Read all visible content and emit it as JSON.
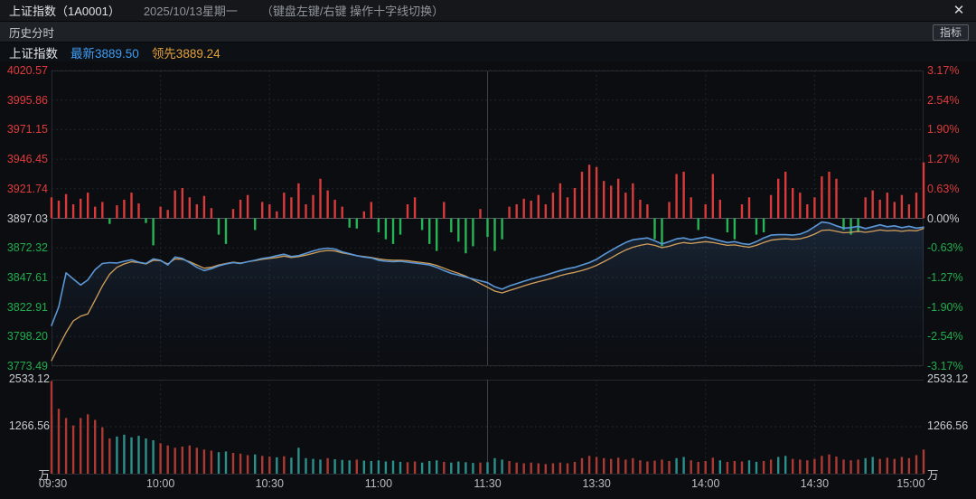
{
  "header": {
    "title": "上证指数（1A0001）",
    "date": "2025/10/13星期一",
    "hint": "（键盘左键/右键 操作十字线切换）",
    "close_icon": "✕",
    "subtitle": "历史分时",
    "indicator_button": "指标"
  },
  "legend": {
    "name": "上证指数",
    "latest": "最新3889.50",
    "lead": "领先3889.24"
  },
  "colors": {
    "up_red": "#e03b3b",
    "down_green": "#21ad4e",
    "neutral": "#c9ced3",
    "price_line": "#5b97d6",
    "avg_line": "#d3a05b",
    "hist_red": "#d93a3a",
    "hist_green": "#26b456",
    "vol_red": "#ad3a32",
    "vol_teal": "#2d8f8a",
    "vol_cyan": "#2fc6c0",
    "latest_blue": "#3f9df5",
    "lead_orange": "#e5a23c",
    "grid": "#21252c",
    "zero_line": "#565b61",
    "lunch_line": "#3d4147",
    "border": "#262a30"
  },
  "chart_data": {
    "type": "line",
    "title": "上证指数 历史分时 2025/10/13",
    "baseline_value": 3897.03,
    "latest_value": 3889.5,
    "lead_value": 3889.24,
    "pct_range": [
      -3.17,
      3.17
    ],
    "left_axis": [
      "4020.57",
      "3995.86",
      "3971.15",
      "3946.45",
      "3921.74",
      "3897.03",
      "3872.32",
      "3847.61",
      "3822.91",
      "3798.20",
      "3773.49"
    ],
    "right_axis": [
      "3.17%",
      "2.54%",
      "1.90%",
      "1.27%",
      "0.63%",
      "0.00%",
      "-0.63%",
      "-1.27%",
      "-1.90%",
      "-2.54%",
      "-3.17%"
    ],
    "axis_colors": [
      "r",
      "r",
      "r",
      "r",
      "r",
      "w",
      "g",
      "g",
      "g",
      "g",
      "g"
    ],
    "x_ticks": [
      "09:30",
      "10:00",
      "10:30",
      "11:00",
      "11:30",
      "13:30",
      "14:00",
      "14:30",
      "15:00"
    ],
    "x_tick_minutes": [
      0,
      30,
      60,
      90,
      120,
      150,
      180,
      210,
      240
    ],
    "sample_step_minutes": 2,
    "volume_axis": [
      "2533.12",
      "1266.56"
    ],
    "volume_unit": "万",
    "volume_max": 2533.12,
    "series": [
      {
        "name": "price_pct",
        "values": [
          -2.3,
          -1.9,
          -1.17,
          -1.3,
          -1.43,
          -1.32,
          -1.1,
          -0.97,
          -0.95,
          -0.96,
          -0.92,
          -0.89,
          -0.94,
          -0.97,
          -0.87,
          -0.9,
          -1.0,
          -0.83,
          -0.86,
          -0.95,
          -1.05,
          -1.12,
          -1.08,
          -1.02,
          -0.98,
          -0.95,
          -0.97,
          -0.93,
          -0.9,
          -0.86,
          -0.84,
          -0.8,
          -0.77,
          -0.82,
          -0.8,
          -0.75,
          -0.7,
          -0.66,
          -0.64,
          -0.66,
          -0.72,
          -0.76,
          -0.8,
          -0.83,
          -0.85,
          -0.9,
          -0.92,
          -0.93,
          -0.92,
          -0.94,
          -0.96,
          -0.98,
          -1.0,
          -1.05,
          -1.12,
          -1.18,
          -1.22,
          -1.26,
          -1.3,
          -1.34,
          -1.38,
          -1.47,
          -1.52,
          -1.45,
          -1.4,
          -1.35,
          -1.3,
          -1.26,
          -1.22,
          -1.17,
          -1.12,
          -1.08,
          -1.05,
          -1.0,
          -0.95,
          -0.88,
          -0.78,
          -0.69,
          -0.6,
          -0.52,
          -0.46,
          -0.44,
          -0.42,
          -0.48,
          -0.55,
          -0.5,
          -0.44,
          -0.42,
          -0.46,
          -0.43,
          -0.4,
          -0.44,
          -0.48,
          -0.52,
          -0.5,
          -0.54,
          -0.56,
          -0.5,
          -0.42,
          -0.36,
          -0.35,
          -0.35,
          -0.36,
          -0.34,
          -0.28,
          -0.18,
          -0.08,
          -0.1,
          -0.16,
          -0.21,
          -0.2,
          -0.17,
          -0.22,
          -0.18,
          -0.14,
          -0.18,
          -0.16,
          -0.2,
          -0.17,
          -0.21,
          -0.19
        ]
      },
      {
        "name": "avg_pct",
        "values": [
          -3.05,
          -2.75,
          -2.45,
          -2.2,
          -2.1,
          -2.05,
          -1.75,
          -1.45,
          -1.2,
          -1.05,
          -0.98,
          -0.93,
          -0.95,
          -0.98,
          -0.9,
          -0.91,
          -0.98,
          -0.87,
          -0.88,
          -0.93,
          -1.0,
          -1.07,
          -1.05,
          -1.0,
          -0.97,
          -0.94,
          -0.96,
          -0.93,
          -0.91,
          -0.88,
          -0.86,
          -0.84,
          -0.81,
          -0.84,
          -0.82,
          -0.79,
          -0.75,
          -0.71,
          -0.69,
          -0.7,
          -0.74,
          -0.77,
          -0.8,
          -0.82,
          -0.84,
          -0.87,
          -0.89,
          -0.9,
          -0.9,
          -0.91,
          -0.93,
          -0.95,
          -0.97,
          -1.01,
          -1.07,
          -1.13,
          -1.18,
          -1.24,
          -1.32,
          -1.4,
          -1.48,
          -1.56,
          -1.6,
          -1.55,
          -1.5,
          -1.45,
          -1.4,
          -1.36,
          -1.32,
          -1.28,
          -1.23,
          -1.19,
          -1.16,
          -1.12,
          -1.07,
          -1.01,
          -0.93,
          -0.85,
          -0.76,
          -0.68,
          -0.62,
          -0.58,
          -0.55,
          -0.58,
          -0.63,
          -0.6,
          -0.55,
          -0.52,
          -0.54,
          -0.52,
          -0.5,
          -0.52,
          -0.55,
          -0.58,
          -0.57,
          -0.6,
          -0.62,
          -0.58,
          -0.52,
          -0.47,
          -0.45,
          -0.44,
          -0.45,
          -0.44,
          -0.4,
          -0.34,
          -0.26,
          -0.25,
          -0.28,
          -0.31,
          -0.3,
          -0.28,
          -0.3,
          -0.28,
          -0.25,
          -0.27,
          -0.26,
          -0.28,
          -0.26,
          -0.27,
          -0.22
        ]
      },
      {
        "name": "minute_change_pct",
        "values": [
          0.45,
          0.38,
          0.52,
          0.3,
          0.42,
          0.55,
          0.25,
          0.35,
          -0.12,
          0.28,
          0.4,
          0.55,
          0.32,
          -0.1,
          -0.58,
          0.25,
          0.18,
          0.6,
          0.65,
          0.45,
          0.3,
          0.48,
          0.22,
          -0.35,
          -0.55,
          0.2,
          0.4,
          0.5,
          -0.25,
          0.35,
          0.3,
          0.15,
          0.55,
          0.45,
          0.75,
          0.3,
          0.5,
          0.85,
          0.6,
          0.4,
          0.25,
          -0.2,
          -0.22,
          0.15,
          0.35,
          -0.3,
          -0.45,
          -0.55,
          -0.35,
          0.3,
          0.45,
          -0.25,
          -0.55,
          -0.7,
          0.35,
          -0.3,
          -0.5,
          -0.75,
          -0.6,
          0.2,
          -0.4,
          -0.7,
          -0.45,
          0.25,
          0.3,
          0.42,
          0.38,
          0.5,
          0.3,
          0.55,
          0.75,
          0.45,
          0.65,
          1.0,
          1.15,
          1.1,
          0.8,
          0.7,
          0.85,
          0.55,
          0.75,
          0.4,
          0.3,
          -0.45,
          -0.6,
          0.35,
          0.95,
          1.0,
          0.45,
          -0.25,
          0.3,
          0.95,
          0.4,
          -0.3,
          -0.45,
          0.3,
          0.45,
          -0.35,
          -0.3,
          0.5,
          0.85,
          1.0,
          0.65,
          0.55,
          0.3,
          0.45,
          0.9,
          1.0,
          0.85,
          -0.25,
          -0.35,
          -0.3,
          0.45,
          0.6,
          0.4,
          0.55,
          0.35,
          0.5,
          0.3,
          0.55,
          1.2
        ]
      },
      {
        "name": "volume_wan",
        "values": [
          2500,
          1750,
          1500,
          1300,
          1500,
          1600,
          1450,
          1250,
          950,
          1000,
          1050,
          980,
          1020,
          950,
          900,
          820,
          760,
          700,
          730,
          760,
          700,
          650,
          620,
          580,
          600,
          560,
          540,
          500,
          520,
          480,
          460,
          440,
          470,
          430,
          700,
          420,
          400,
          380,
          420,
          390,
          370,
          360,
          380,
          350,
          340,
          360,
          330,
          350,
          320,
          310,
          330,
          300,
          340,
          360,
          320,
          300,
          330,
          310,
          290,
          300,
          310,
          420,
          380,
          340,
          300,
          280,
          300,
          280,
          260,
          280,
          300,
          280,
          320,
          420,
          480,
          450,
          420,
          400,
          430,
          380,
          420,
          360,
          330,
          350,
          380,
          340,
          420,
          450,
          360,
          320,
          340,
          430,
          360,
          320,
          340,
          330,
          360,
          320,
          340,
          380,
          450,
          480,
          400,
          380,
          360,
          400,
          480,
          520,
          460,
          380,
          360,
          380,
          420,
          450,
          400,
          430,
          400,
          450,
          420,
          500,
          650
        ]
      }
    ],
    "volume_bar_colors": "rrrrrrrrrggggggrrrrrrrrggrrrgrrgrgggggrgggrggggggrrgggrggggrgggrrrrrrrrrrrrrrrrrrrrrrrggrrrrgrrrggrrggrrrrrrrrrrggrrrrrrrrc"
  }
}
